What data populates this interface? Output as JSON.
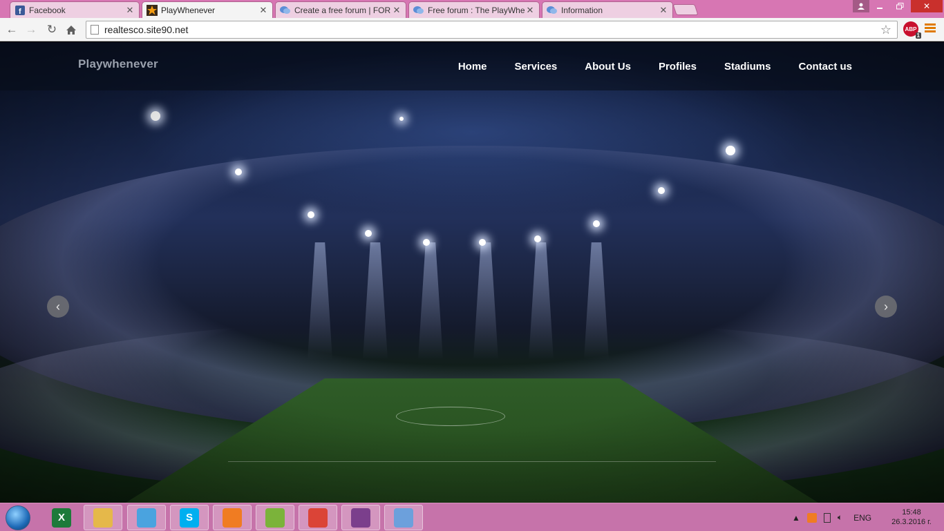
{
  "browser": {
    "tabs": [
      {
        "title": "Facebook",
        "favicon": "facebook-icon",
        "active": false
      },
      {
        "title": "PlayWhenever",
        "favicon": "star-icon",
        "active": true
      },
      {
        "title": "Create a free forum | FOR",
        "favicon": "forum-icon",
        "active": false
      },
      {
        "title": "Free forum : The PlayWhe",
        "favicon": "forum-icon",
        "active": false
      },
      {
        "title": "Information",
        "favicon": "forum-icon",
        "active": false
      }
    ],
    "url": "realtesco.site90.net",
    "adblock_label": "ABP",
    "adblock_count": "1"
  },
  "site": {
    "brand": "Playwhenever",
    "nav": [
      "Home",
      "Services",
      "About Us",
      "Profiles",
      "Stadiums",
      "Contact us"
    ]
  },
  "carousel": {
    "prev_symbol": "‹",
    "next_symbol": "›"
  },
  "taskbar": {
    "apps": [
      {
        "name": "excel-icon",
        "label": "X",
        "color": "#1d7a3a"
      },
      {
        "name": "file-explorer-icon",
        "label": "",
        "color": "#e5b84a"
      },
      {
        "name": "browser-ball-icon",
        "label": "",
        "color": "#4aa3df"
      },
      {
        "name": "skype-icon",
        "label": "S",
        "color": "#00aff0"
      },
      {
        "name": "xampp-icon",
        "label": "",
        "color": "#f07c22"
      },
      {
        "name": "notepad-plus-icon",
        "label": "",
        "color": "#7bb33a"
      },
      {
        "name": "chrome-icon",
        "label": "",
        "color": "#db4437"
      },
      {
        "name": "winrar-icon",
        "label": "",
        "color": "#7b3f8c"
      },
      {
        "name": "paint-icon",
        "label": "",
        "color": "#6ca0dc"
      }
    ],
    "tray_language": "ENG",
    "time": "15:48",
    "date": "26.3.2016 г."
  }
}
